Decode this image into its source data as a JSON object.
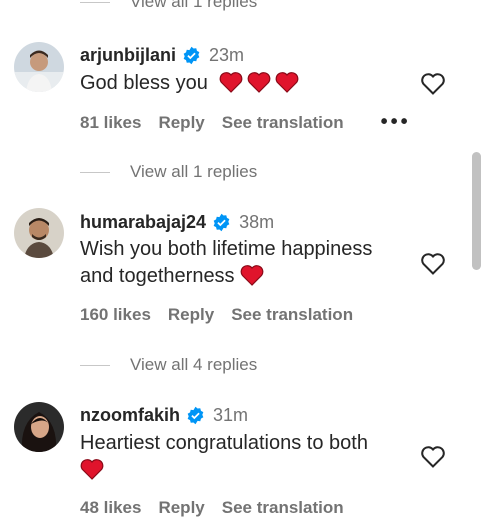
{
  "comments": [
    {
      "username": "arjunbijlani",
      "time": "23m",
      "text": "God bless you",
      "hearts": 3,
      "likes": "81 likes",
      "reply": "Reply",
      "translate": "See translation",
      "more": "•••",
      "view_replies": "View all 1 replies"
    },
    {
      "username": "humarabajaj24",
      "time": "38m",
      "text_line1": "Wish you both lifetime happiness",
      "text_line2": "and togetherness",
      "hearts": 1,
      "likes": "160 likes",
      "reply": "Reply",
      "translate": "See translation",
      "view_replies": "View all 4 replies"
    },
    {
      "username": "nzoomfakih",
      "time": "31m",
      "text": "Heartiest congratulations to both",
      "hearts": 1,
      "likes": "48 likes",
      "reply": "Reply",
      "translate": "See translation"
    }
  ],
  "top_view_replies": "View all 1 replies",
  "colors": {
    "verified": "#0095f6",
    "heart_emoji": "#e0142c",
    "secondary_text": "#737373"
  },
  "icons": [
    "verified-badge-icon",
    "heart-outline-icon",
    "red-heart-emoji"
  ]
}
